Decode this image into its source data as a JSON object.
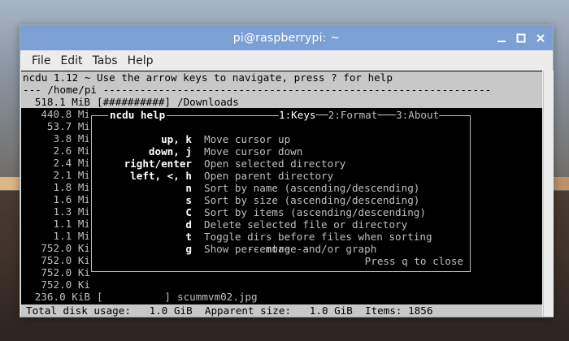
{
  "window": {
    "title": "pi@raspberrypi: ~"
  },
  "menu": {
    "items": [
      "File",
      "Edit",
      "Tabs",
      "Help"
    ]
  },
  "terminal": {
    "header": "ncdu 1.12 ~ Use the arrow keys to navigate, press ? for help",
    "path_line": "--- /home/pi ---------------------------------------------------------------",
    "rows": [
      {
        "size": "518.1 MiB",
        "bar": "[##########]",
        "name": "/Downloads",
        "selected": true
      },
      {
        "size": "440.8 Mi",
        "bar": "",
        "name": ""
      },
      {
        "size": "53.7 Mi",
        "bar": "",
        "name": ""
      },
      {
        "size": "3.8 Mi",
        "bar": "",
        "name": ""
      },
      {
        "size": "2.6 Mi",
        "bar": "",
        "name": ""
      },
      {
        "size": "2.4 Mi",
        "bar": "",
        "name": ""
      },
      {
        "size": "2.1 Mi",
        "bar": "",
        "name": ""
      },
      {
        "size": "1.8 Mi",
        "bar": "",
        "name": ""
      },
      {
        "size": "1.6 Mi",
        "bar": "",
        "name": ""
      },
      {
        "size": "1.3 Mi",
        "bar": "",
        "name": ""
      },
      {
        "size": "1.1 Mi",
        "bar": "",
        "name": ""
      },
      {
        "size": "1.1 Mi",
        "bar": "",
        "name": ""
      },
      {
        "size": "752.0 Ki",
        "bar": "",
        "name": ""
      },
      {
        "size": "752.0 Ki",
        "bar": "",
        "name": ""
      },
      {
        "size": "752.0 Ki",
        "bar": "",
        "name": ""
      },
      {
        "size": "752.0 Ki",
        "bar": "",
        "name": ""
      },
      {
        "size": "236.0 KiB",
        "bar": "[          ]",
        "name": "scummvm02.jpg"
      }
    ],
    "status": "Total disk usage:   1.0 GiB  Apparent size:   1.0 GiB  Items: 1856"
  },
  "help": {
    "title": "ncdu help",
    "tabs": [
      "1:Keys",
      "2:Format",
      "3:About"
    ],
    "bindings": [
      {
        "key": "up, k",
        "desc": "Move cursor up"
      },
      {
        "key": "down, j",
        "desc": "Move cursor down"
      },
      {
        "key": "right/enter",
        "desc": "Open selected directory"
      },
      {
        "key": "left, <, h",
        "desc": "Open parent directory"
      },
      {
        "key": "n",
        "desc": "Sort by name (ascending/descending)"
      },
      {
        "key": "s",
        "desc": "Sort by size (ascending/descending)"
      },
      {
        "key": "C",
        "desc": "Sort by items (ascending/descending)"
      },
      {
        "key": "d",
        "desc": "Delete selected file or directory"
      },
      {
        "key": "t",
        "desc": "Toggle dirs before files when sorting"
      },
      {
        "key": "g",
        "desc": "Show percentage and/or graph"
      }
    ],
    "more": "-- more --",
    "close_hint": "Press q to close"
  },
  "colors": {
    "titlebar": "#7ca0d4",
    "terminal_bg": "#000000",
    "highlight": "#c8c8c8"
  }
}
